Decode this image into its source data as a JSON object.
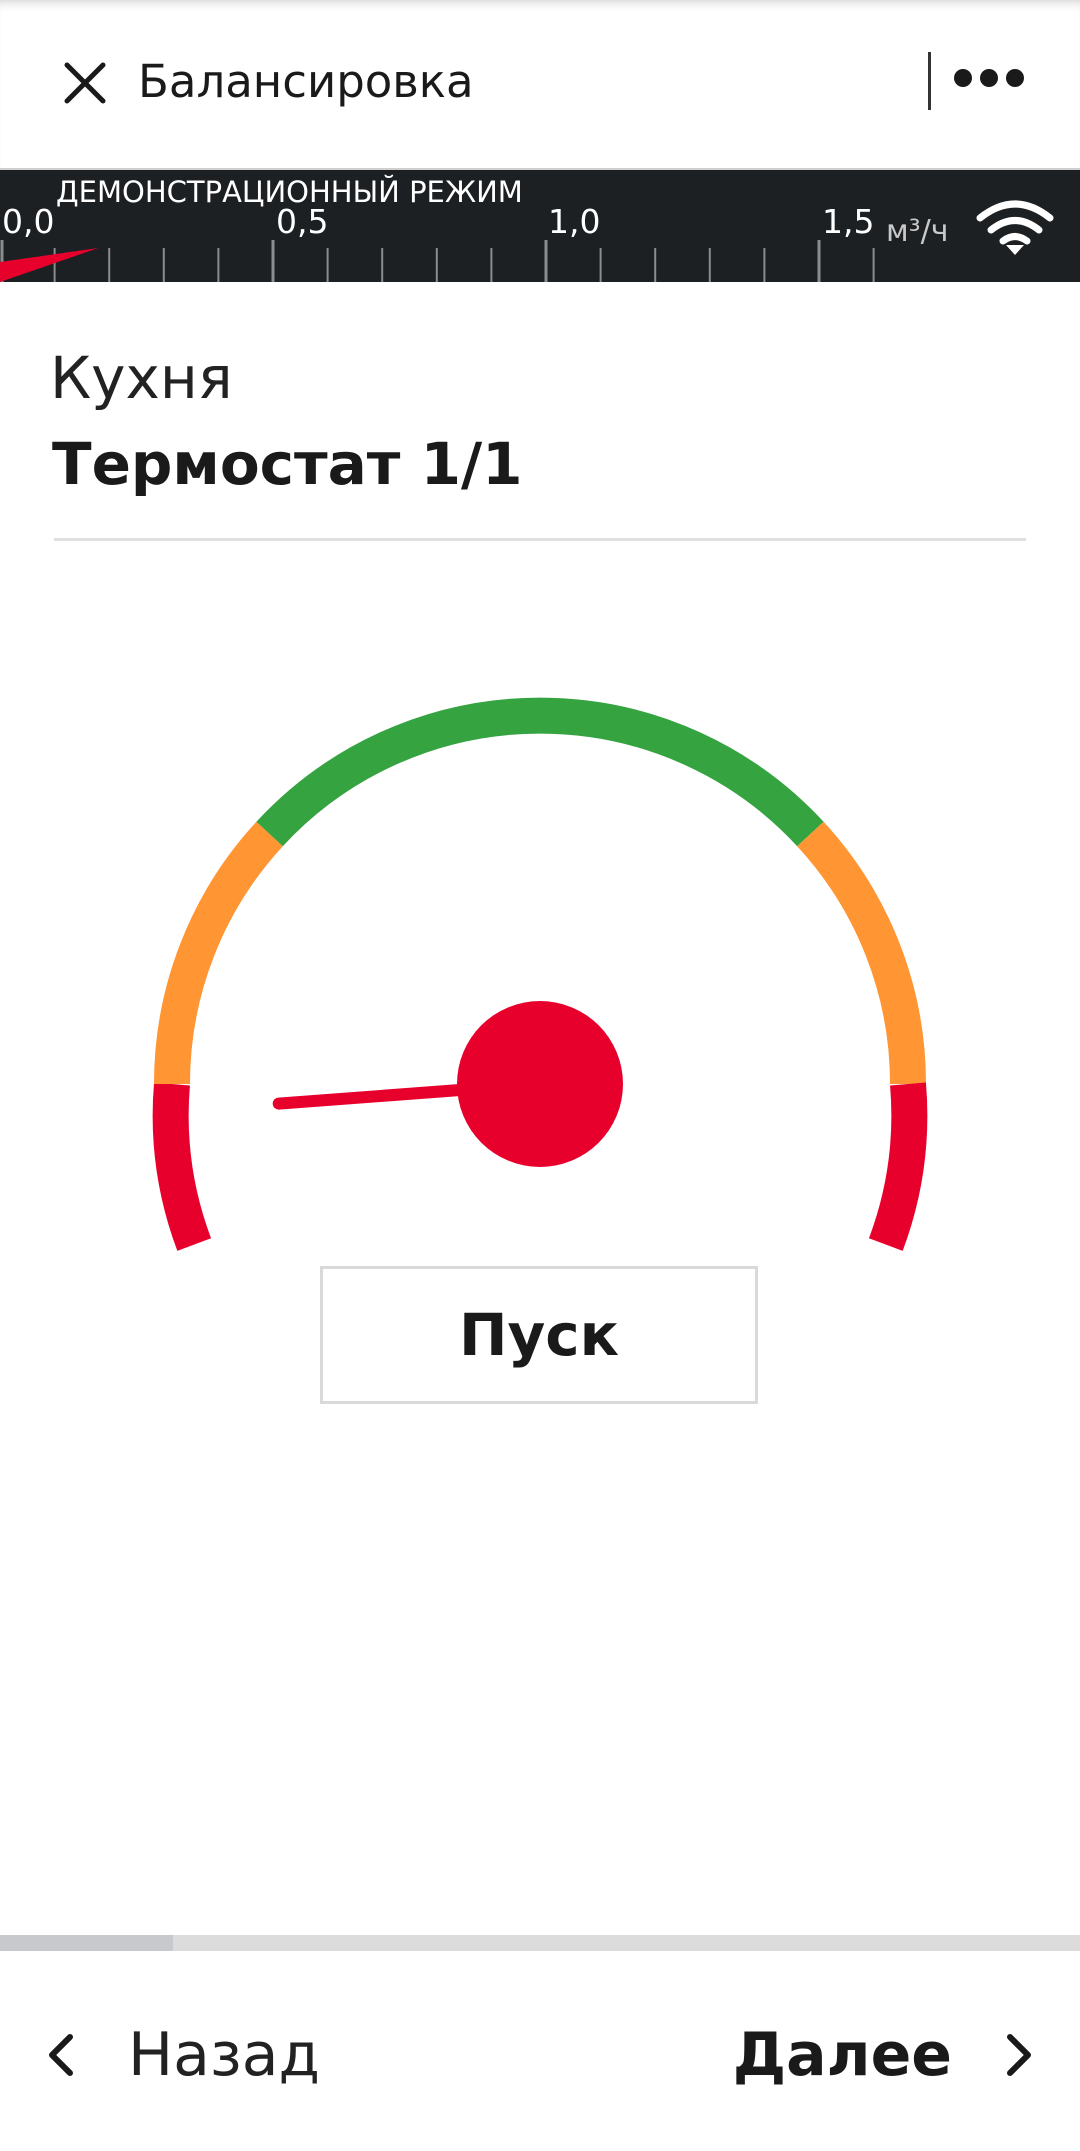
{
  "header": {
    "title": "Балансировка",
    "close_icon": "close-icon",
    "more_icon": "more-horizontal-icon"
  },
  "demo_bar": {
    "title": "ДЕМОНСТРАЦИОННЫЙ РЕЖИМ",
    "scale_labels": [
      "0,0",
      "0,5",
      "1,0",
      "1,5"
    ],
    "unit": "м³/ч",
    "current_flow_fraction": 0.06,
    "signal_icon": "wifi-icon",
    "indicator_color": "#e8002d"
  },
  "location": {
    "room": "Кухня",
    "device": "Термостат 1/1"
  },
  "gauge": {
    "needle_value_fraction": 0.09,
    "colors": {
      "low": "#e8002d",
      "warn": "#ff9533",
      "ok": "#35a340",
      "needle": "#e8002d"
    }
  },
  "actions": {
    "start_label": "Пуск"
  },
  "progress": {
    "fraction": 0.16
  },
  "footer": {
    "back_label": "Назад",
    "next_label": "Далее",
    "back_icon": "chevron-left-icon",
    "next_icon": "chevron-right-icon"
  }
}
